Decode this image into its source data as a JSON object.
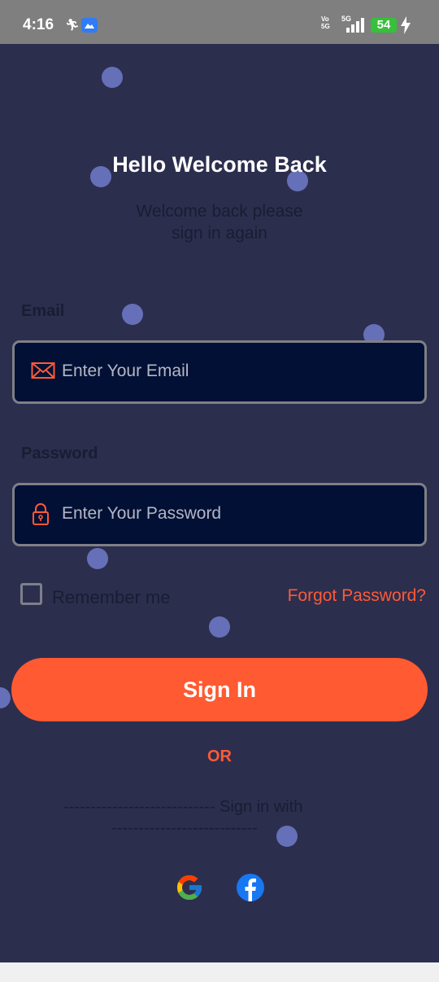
{
  "status_bar": {
    "time": "4:16",
    "battery": "54",
    "network": "5G",
    "volte": "Vo LTE"
  },
  "login": {
    "title": "Hello Welcome Back",
    "subtitle_line1": "Welcome back please",
    "subtitle_line2": "sign in again",
    "email_label": "Email",
    "email_placeholder": "Enter Your Email",
    "password_label": "Password",
    "password_placeholder": "Enter Your Password",
    "remember_label": "Remember me",
    "forgot_label": "Forgot Password?",
    "signin_label": "Sign In",
    "or_label": "OR",
    "sign_in_with_line1": "----------------------------  Sign in with",
    "sign_in_with_line2": "---------------------------"
  },
  "social": [
    {
      "name": "google",
      "icon": "google-icon"
    },
    {
      "name": "facebook",
      "icon": "facebook-icon"
    }
  ],
  "colors": {
    "background": "#2c2e4e",
    "accent": "#ff5a32",
    "field_bg": "#011034",
    "dots": "#6670b8"
  }
}
